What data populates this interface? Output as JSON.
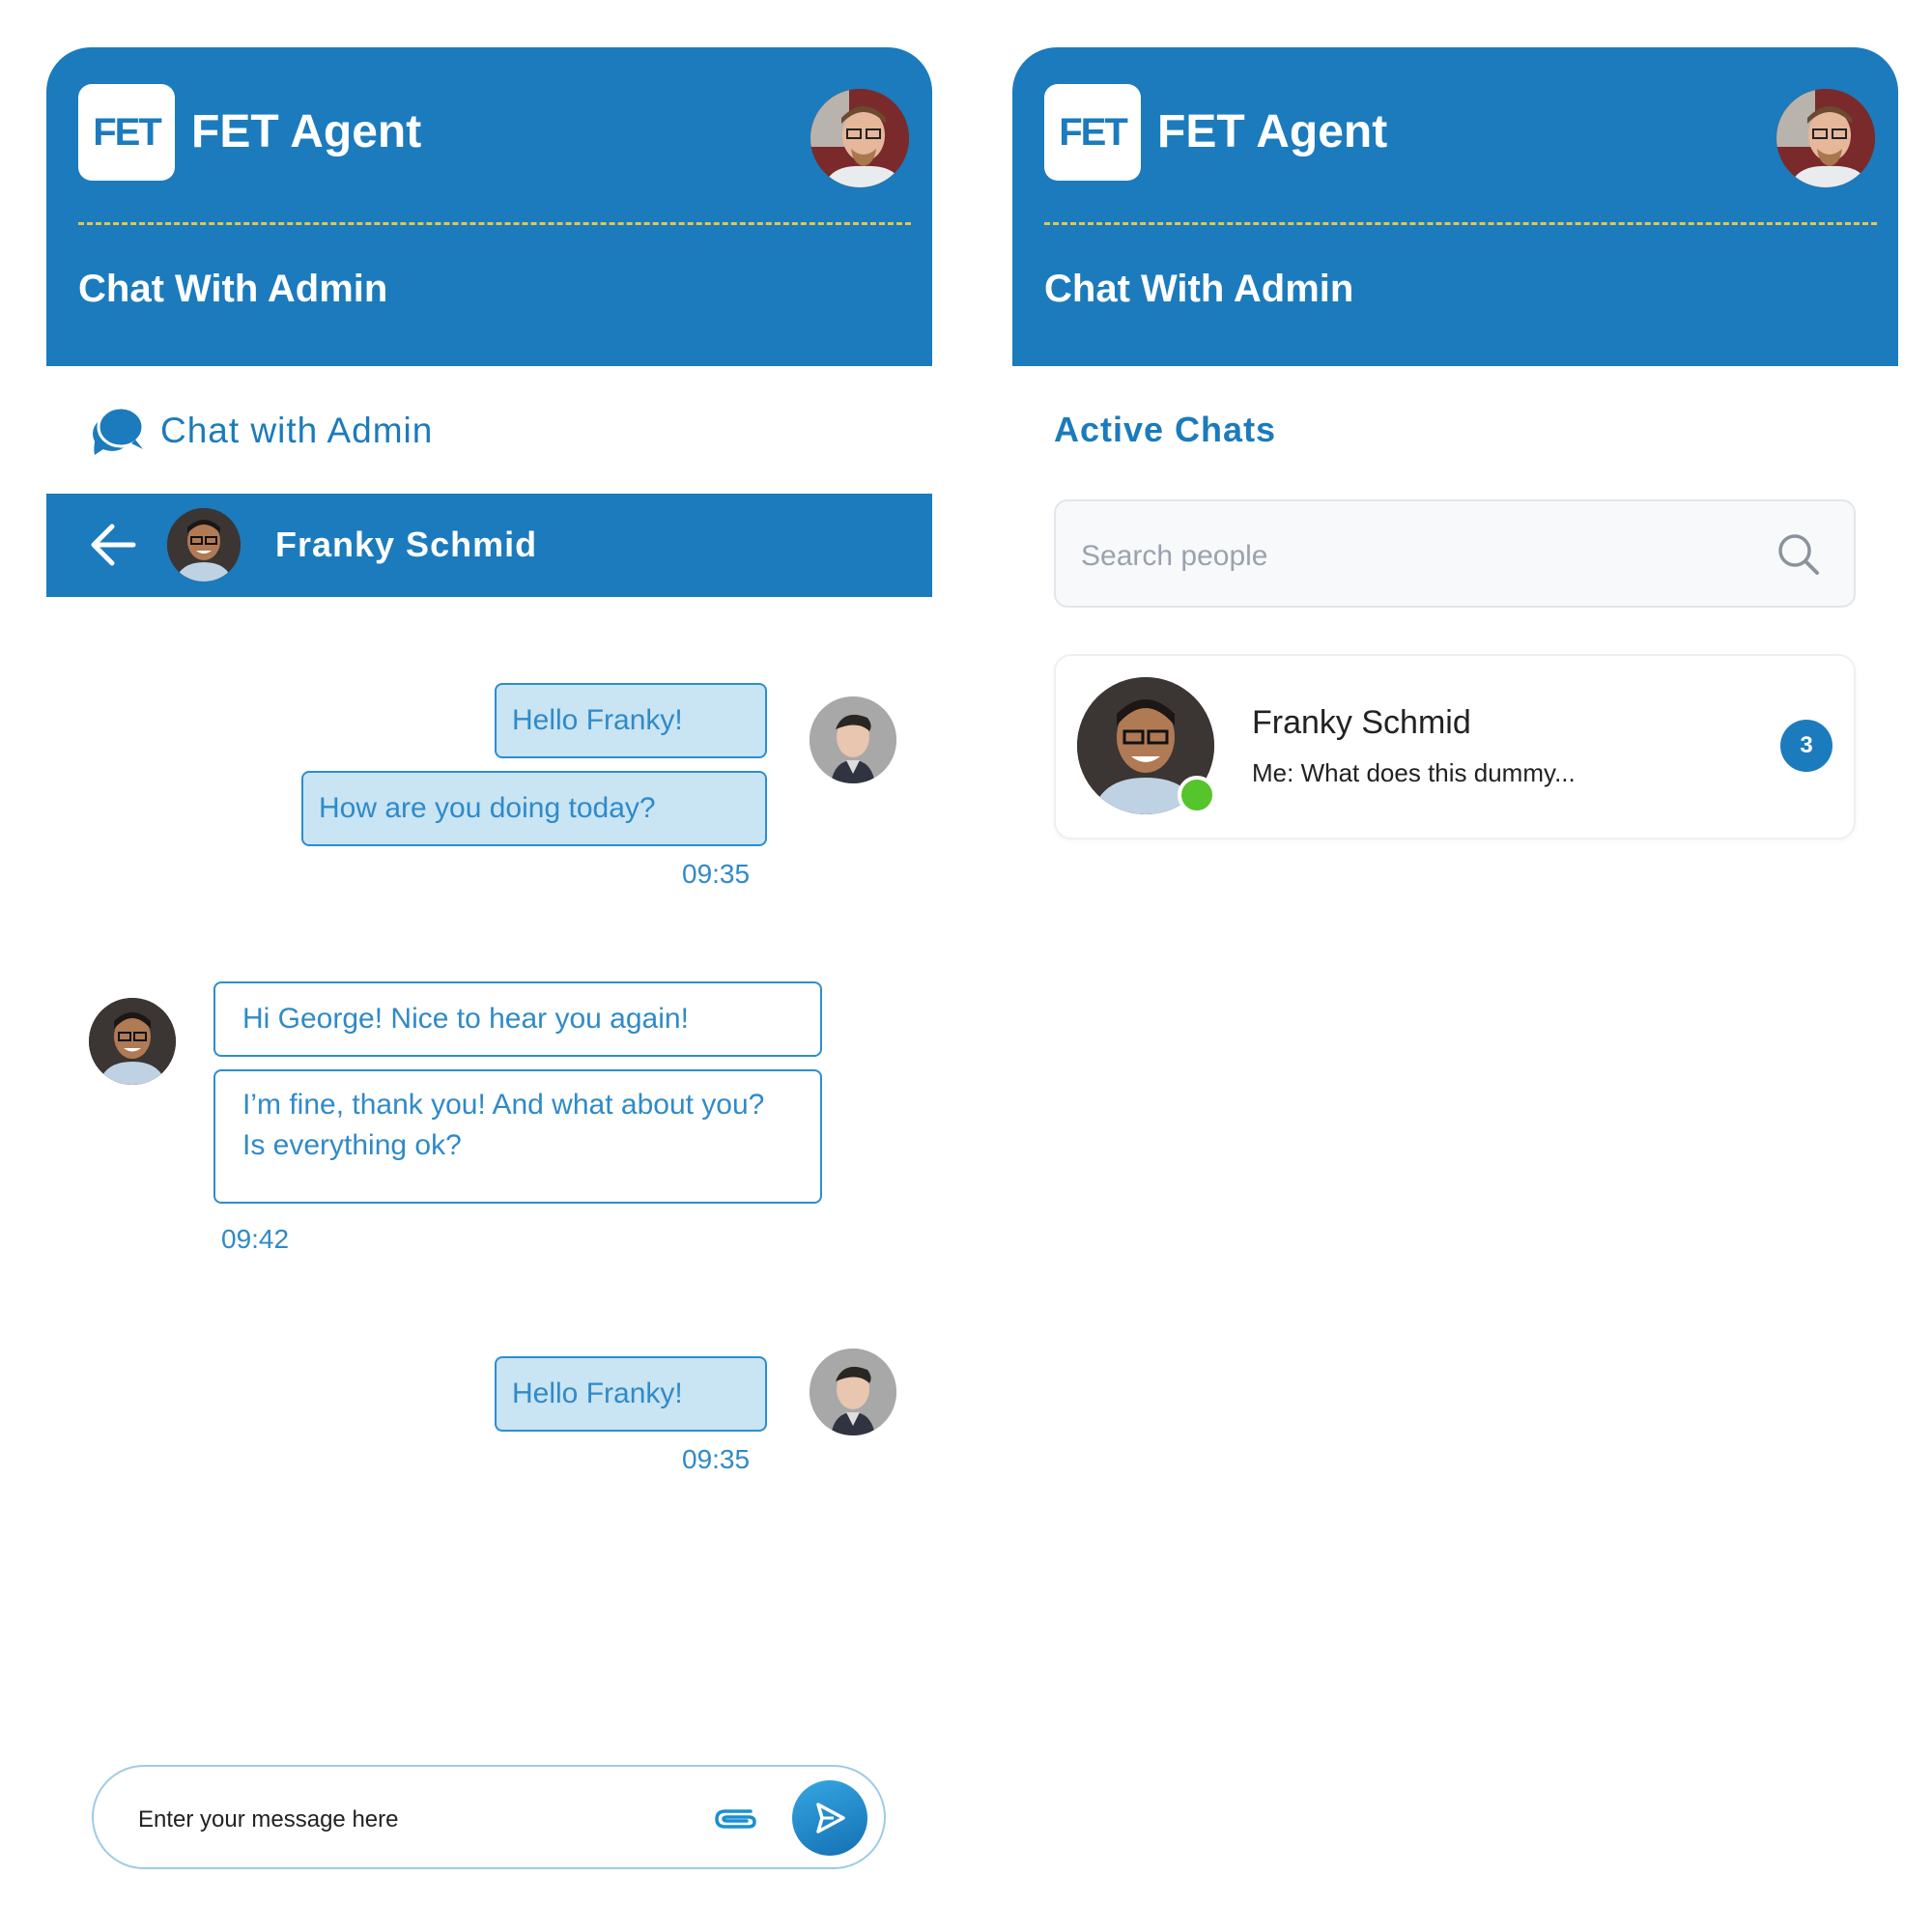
{
  "brand": {
    "logo_text": "FET",
    "app_title": "FET Agent",
    "subtitle": "Chat With Admin",
    "primary_color": "#1b7bbd",
    "accent_dash_color": "#e0c84a"
  },
  "left": {
    "section_title": "Chat with Admin",
    "contact": {
      "name": "Franky Schmid"
    },
    "messages": [
      {
        "direction": "out",
        "bubbles": [
          "Hello Franky!",
          "How are you doing today?"
        ],
        "time": "09:35"
      },
      {
        "direction": "in",
        "bubbles": [
          "Hi George! Nice to hear you again!",
          "I’m fine, thank you! And what about you? Is everything ok?"
        ],
        "time": "09:42"
      },
      {
        "direction": "out",
        "bubbles": [
          "Hello Franky!"
        ],
        "time": "09:35"
      }
    ],
    "composer": {
      "placeholder": "Enter your message here"
    }
  },
  "right": {
    "section_title": "Active Chats",
    "search": {
      "placeholder": "Search people"
    },
    "chats": [
      {
        "name": "Franky Schmid",
        "preview": "Me: What does this dummy...",
        "unread": "3",
        "online": true,
        "online_color": "#56c42b"
      }
    ]
  }
}
